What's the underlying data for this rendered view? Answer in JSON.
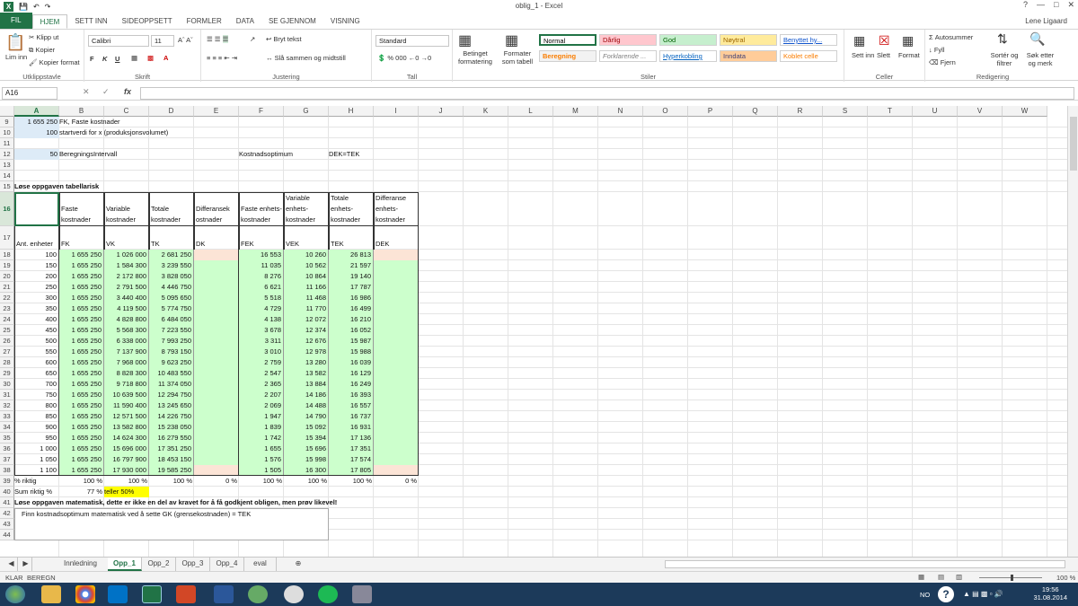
{
  "window": {
    "title": "oblig_1 - Excel",
    "user": "Lene Ligaard"
  },
  "tabs": [
    "FIL",
    "HJEM",
    "SETT INN",
    "SIDEOPPSETT",
    "FORMLER",
    "DATA",
    "SE GJENNOM",
    "VISNING"
  ],
  "ribbon": {
    "clipboard": {
      "paste": "Lim inn",
      "cut": "Klipp ut",
      "copy": "Kopier",
      "painter": "Kopier format",
      "label": "Utklippstavle"
    },
    "font": {
      "name": "Calibri",
      "size": "11",
      "bold": "F",
      "italic": "K",
      "underline": "U",
      "label": "Skrift"
    },
    "align": {
      "wrap": "Bryt tekst",
      "merge": "Slå sammen og midtstill",
      "label": "Justering"
    },
    "number": {
      "format": "Standard",
      "label": "Tall"
    },
    "styles": {
      "cond": "Betinget formatering",
      "table": "Formater som tabell",
      "label": "Stiler",
      "items": [
        "Normal",
        "Dårlig",
        "God",
        "Nøytral",
        "Benyttet hy...",
        "Beregning",
        "Forklarende ...",
        "Hyperkobling",
        "Inndata",
        "Koblet celle"
      ]
    },
    "cells": {
      "insert": "Sett inn",
      "delete": "Slett",
      "format": "Format",
      "label": "Celler"
    },
    "editing": {
      "autosum": "Autosummer",
      "fill": "Fyll",
      "clear": "Fjern",
      "sort": "Sortér og filtrer",
      "find": "Søk etter og merk",
      "label": "Redigering"
    }
  },
  "formula": {
    "namebox": "A16",
    "fx": "fx",
    "content": ""
  },
  "columns": [
    "A",
    "B",
    "C",
    "D",
    "E",
    "F",
    "G",
    "H",
    "I",
    "J",
    "K",
    "L",
    "M",
    "N",
    "O",
    "P",
    "Q",
    "R",
    "S",
    "T",
    "U",
    "V",
    "W"
  ],
  "rownums": [
    "9",
    "10",
    "11",
    "12",
    "13",
    "14",
    "15",
    "16",
    "17",
    "18",
    "19",
    "20",
    "21",
    "22",
    "23",
    "24",
    "25",
    "26",
    "27",
    "28",
    "29",
    "30",
    "31",
    "32",
    "33",
    "34",
    "35",
    "36",
    "37",
    "38",
    "39",
    "40",
    "41",
    "42",
    "43",
    "44"
  ],
  "top": {
    "r9a": "1 655 250",
    "r9b": "FK, Faste kostnader",
    "r10a": "100",
    "r10b": "startverdi for x (produksjonsvolumet)",
    "r12a": "50",
    "r12b": "BeregningsIntervall",
    "r12f": "Kostnadsoptimum",
    "r12h": "DEK=TEK",
    "r15": "Løse oppgaven tabellarisk"
  },
  "headers": {
    "h16": [
      "",
      "Faste kostnader",
      "Variable kostnader",
      "Totale kostnader",
      "Differansek ostnader",
      "Faste enhets- kostnader",
      "Variable enhets- kostnader",
      "Totale enhets- kostnader",
      "Differanse enhets- kostnader"
    ],
    "h17": [
      "Ant. enheter",
      "FK",
      "VK",
      "TK",
      "DK",
      "FEK",
      "VEK",
      "TEK",
      "DEK"
    ]
  },
  "table": [
    [
      "100",
      "1 655 250",
      "1 026 000",
      "2 681 250",
      "16 553",
      "10 260",
      "26 813"
    ],
    [
      "150",
      "1 655 250",
      "1 584 300",
      "3 239 550",
      "11 035",
      "10 562",
      "21 597"
    ],
    [
      "200",
      "1 655 250",
      "2 172 800",
      "3 828 050",
      "8 276",
      "10 864",
      "19 140"
    ],
    [
      "250",
      "1 655 250",
      "2 791 500",
      "4 446 750",
      "6 621",
      "11 166",
      "17 787"
    ],
    [
      "300",
      "1 655 250",
      "3 440 400",
      "5 095 650",
      "5 518",
      "11 468",
      "16 986"
    ],
    [
      "350",
      "1 655 250",
      "4 119 500",
      "5 774 750",
      "4 729",
      "11 770",
      "16 499"
    ],
    [
      "400",
      "1 655 250",
      "4 828 800",
      "6 484 050",
      "4 138",
      "12 072",
      "16 210"
    ],
    [
      "450",
      "1 655 250",
      "5 568 300",
      "7 223 550",
      "3 678",
      "12 374",
      "16 052"
    ],
    [
      "500",
      "1 655 250",
      "6 338 000",
      "7 993 250",
      "3 311",
      "12 676",
      "15 987"
    ],
    [
      "550",
      "1 655 250",
      "7 137 900",
      "8 793 150",
      "3 010",
      "12 978",
      "15 988"
    ],
    [
      "600",
      "1 655 250",
      "7 968 000",
      "9 623 250",
      "2 759",
      "13 280",
      "16 039"
    ],
    [
      "650",
      "1 655 250",
      "8 828 300",
      "10 483 550",
      "2 547",
      "13 582",
      "16 129"
    ],
    [
      "700",
      "1 655 250",
      "9 718 800",
      "11 374 050",
      "2 365",
      "13 884",
      "16 249"
    ],
    [
      "750",
      "1 655 250",
      "10 639 500",
      "12 294 750",
      "2 207",
      "14 186",
      "16 393"
    ],
    [
      "800",
      "1 655 250",
      "11 590 400",
      "13 245 650",
      "2 069",
      "14 488",
      "16 557"
    ],
    [
      "850",
      "1 655 250",
      "12 571 500",
      "14 226 750",
      "1 947",
      "14 790",
      "16 737"
    ],
    [
      "900",
      "1 655 250",
      "13 582 800",
      "15 238 050",
      "1 839",
      "15 092",
      "16 931"
    ],
    [
      "950",
      "1 655 250",
      "14 624 300",
      "16 279 550",
      "1 742",
      "15 394",
      "17 136"
    ],
    [
      "1 000",
      "1 655 250",
      "15 696 000",
      "17 351 250",
      "1 655",
      "15 696",
      "17 351"
    ],
    [
      "1 050",
      "1 655 250",
      "16 797 900",
      "18 453 150",
      "1 576",
      "15 998",
      "17 574"
    ],
    [
      "1 100",
      "1 655 250",
      "17 930 000",
      "19 585 250",
      "1 505",
      "16 300",
      "17 805"
    ]
  ],
  "bottom": {
    "r39": [
      "% riktig",
      "100 %",
      "100 %",
      "100 %",
      "0 %",
      "100 %",
      "100 %",
      "100 %",
      "0 %"
    ],
    "r40a": "Sum riktig %",
    "r40b": "77 %",
    "r40c": "teller 50%",
    "r41": "Løse oppgaven matematisk, dette er ikke en del av kravet for å få godkjent obligen, men prøv likevel!",
    "r42": "Finn kostnadsoptimum matematisk ved å sette GK (grensekostnaden)  = TEK"
  },
  "sheets": [
    "Innledning",
    "Opp_1",
    "Opp_2",
    "Opp_3",
    "Opp_4",
    "eval"
  ],
  "status": {
    "left1": "KLAR",
    "left2": "BEREGN",
    "zoom": "100 %"
  },
  "taskbar": {
    "lang": "NO",
    "time": "19:56",
    "date": "31.08.2014"
  },
  "colors": {
    "excel": "#217346",
    "green_cell": "#ccffcc",
    "peach_cell": "#fce4d6",
    "blue_cell": "#ddebf7",
    "yellow": "#ffff00"
  }
}
